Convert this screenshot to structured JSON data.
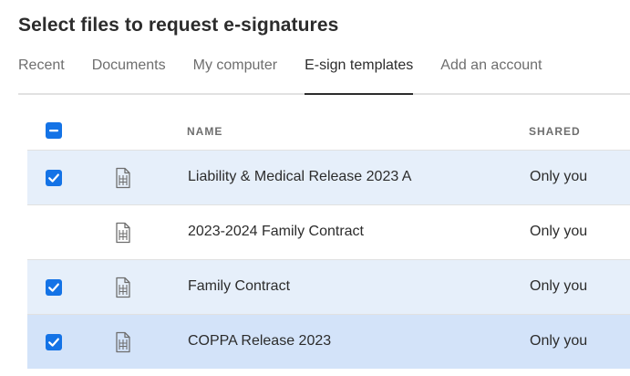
{
  "dialog": {
    "title": "Select files to request e-signatures"
  },
  "tabs": [
    {
      "label": "Recent",
      "active": false
    },
    {
      "label": "Documents",
      "active": false
    },
    {
      "label": "My computer",
      "active": false
    },
    {
      "label": "E-sign templates",
      "active": true
    },
    {
      "label": "Add an account",
      "active": false
    }
  ],
  "table": {
    "select_all_state": "indeterminate",
    "columns": {
      "name": "NAME",
      "shared": "SHARED"
    },
    "rows": [
      {
        "name": "Liability & Medical Release 2023 A",
        "shared": "Only you",
        "checked": true,
        "icon": "template-document-icon"
      },
      {
        "name": "2023-2024 Family Contract",
        "shared": "Only you",
        "checked": false,
        "icon": "template-document-icon"
      },
      {
        "name": "Family Contract",
        "shared": "Only you",
        "checked": true,
        "icon": "template-document-icon"
      },
      {
        "name": "COPPA Release 2023",
        "shared": "Only you",
        "checked": true,
        "icon": "template-document-icon"
      }
    ]
  },
  "colors": {
    "accent": "#1473e6",
    "selected_row": "#e6effa",
    "focused_row": "#d3e3f9"
  }
}
